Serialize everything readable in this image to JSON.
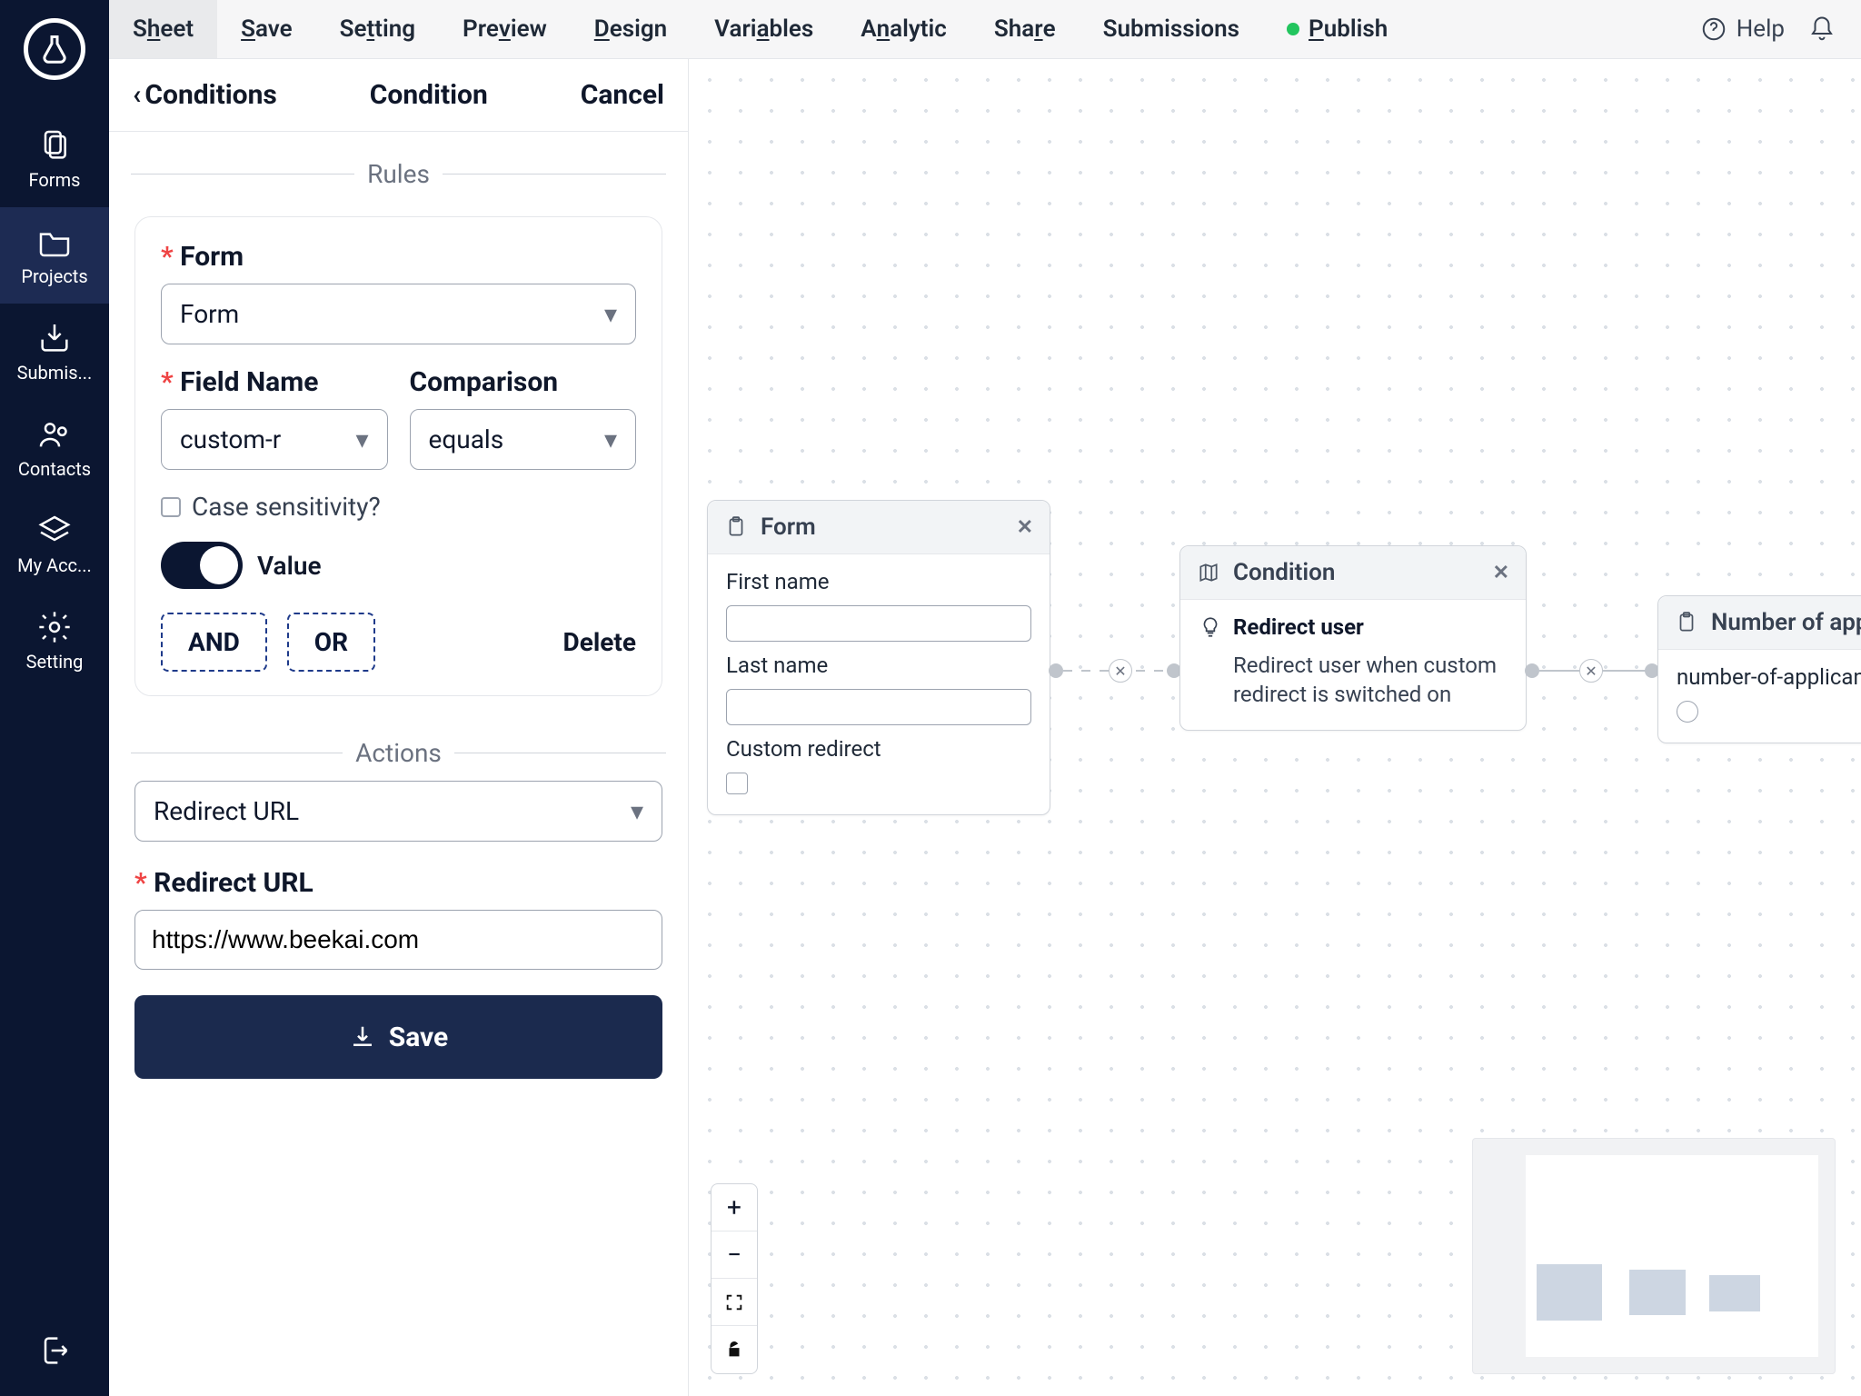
{
  "rail": {
    "items": [
      "Forms",
      "Projects",
      "Submis...",
      "Contacts",
      "My Acc...",
      "Setting"
    ],
    "activeIndex": 1
  },
  "menu": {
    "items": [
      "Sheet",
      "Save",
      "Setting",
      "Preview",
      "Design",
      "Variables",
      "Analytic",
      "Share",
      "Submissions",
      "Publish"
    ],
    "activeIndex": 0,
    "help": "Help"
  },
  "panel": {
    "back": "Conditions",
    "title": "Condition",
    "cancel": "Cancel",
    "rulesLabel": "Rules",
    "actionsLabel": "Actions",
    "formLabel": "Form",
    "formValue": "Form",
    "fieldNameLabel": "Field Name",
    "fieldNameValue": "custom-r",
    "comparisonLabel": "Comparison",
    "comparisonValue": "equals",
    "caseSensitivity": "Case sensitivity?",
    "valueToggleLabel": "Value",
    "valueToggleOn": true,
    "andLabel": "AND",
    "orLabel": "OR",
    "deleteLabel": "Delete",
    "actionSelectValue": "Redirect URL",
    "redirectLabel": "Redirect URL",
    "redirectValue": "https://www.beekai.com",
    "saveLabel": "Save"
  },
  "canvas": {
    "formNode": {
      "title": "Form",
      "fields": {
        "first": "First name",
        "last": "Last name",
        "custom": "Custom redirect"
      }
    },
    "conditionNode": {
      "title": "Condition",
      "heading": "Redirect user",
      "desc": "Redirect user when custom redirect is switched on"
    },
    "applicantsNode": {
      "title": "Number of appl",
      "field": "number-of-applican"
    }
  }
}
